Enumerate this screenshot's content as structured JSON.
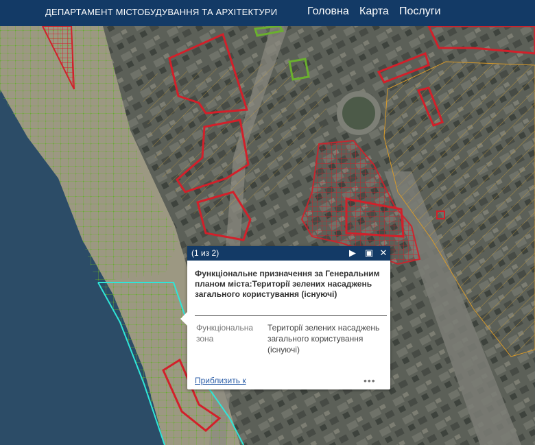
{
  "header": {
    "title": "ДЕПАРТАМЕНТ МІСТОБУДУВАННЯ ТА АРХІТЕКТУРИ",
    "nav": [
      "Головна",
      "Карта",
      "Послуги"
    ]
  },
  "popup": {
    "counter": "(1 из 2)",
    "title": "Функціональне призначення за Генеральним планом міста:Території зелених насаджень загального користування (існуючі)",
    "field_label": "Функціональна зона",
    "field_value": "Території зелених насаджень загального користування (існуючі)",
    "zoom_link": "Приблизить к",
    "more": "•••",
    "icons": [
      "next-arrow-icon",
      "maximize-icon",
      "close-icon"
    ]
  },
  "colors": {
    "header_bg": "#133a66",
    "zone_red": "#d2202a",
    "zone_green": "#6ab02e",
    "zone_cyan": "#2ee6d9",
    "zone_orange": "#d89a2a",
    "water": "#2a4a63"
  }
}
